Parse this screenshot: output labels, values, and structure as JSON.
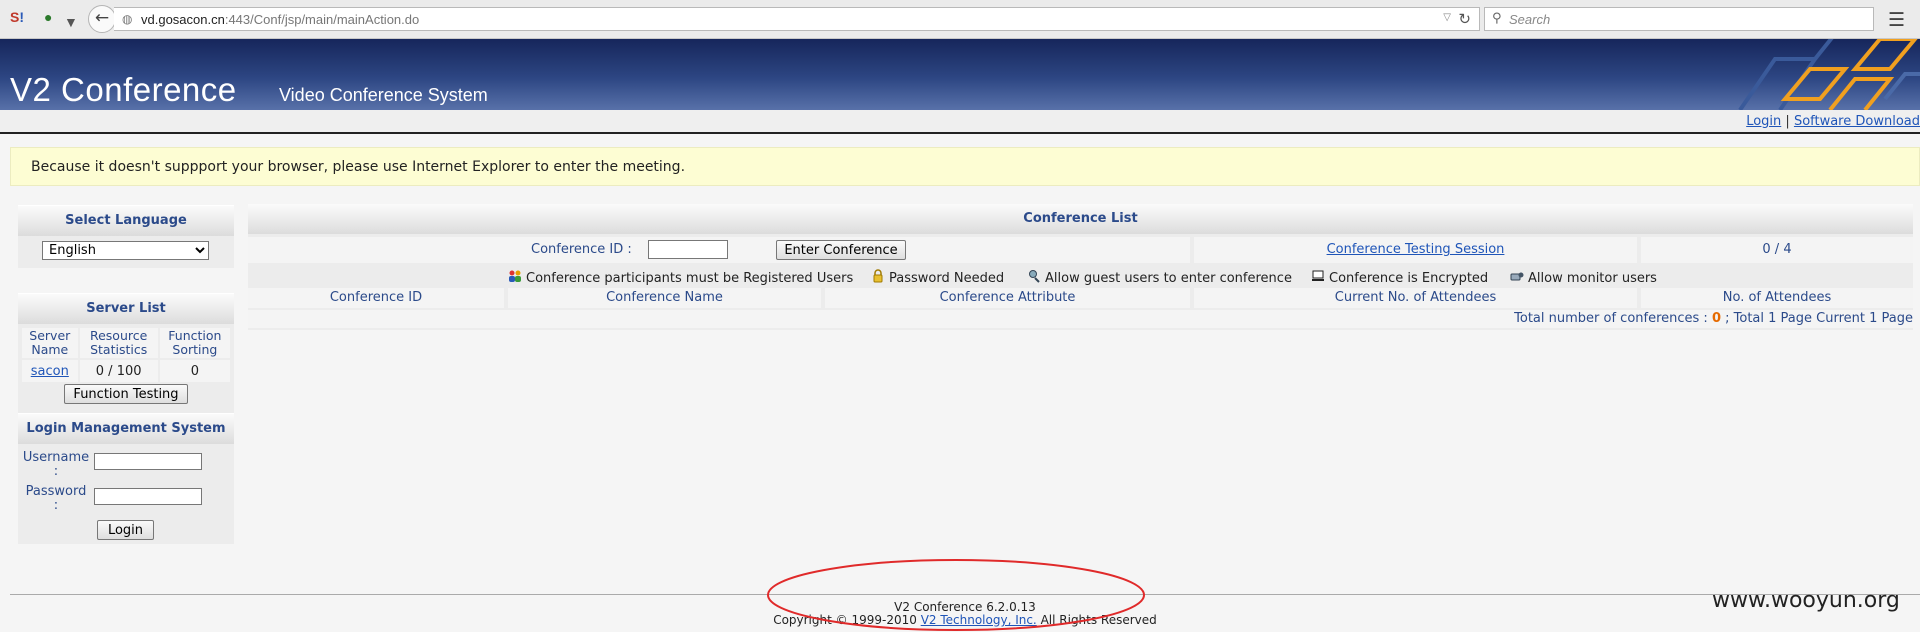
{
  "browser": {
    "url_host": "vd.gosacon.cn",
    "url_rest": ":443/Conf/jsp/main/mainAction.do",
    "search_placeholder": "Search"
  },
  "banner": {
    "title": "V2 Conference",
    "subtitle": "Video Conference System"
  },
  "nav": {
    "login": "Login",
    "separator": "|",
    "software_download": "Software Download"
  },
  "warning": "Because it doesn't suppport your browser, please use Internet Explorer to enter the meeting.",
  "language_panel": {
    "title": "Select Language",
    "selected": "English"
  },
  "server_panel": {
    "title": "Server List",
    "col_server": "Server Name",
    "col_resource": "Resource Statistics",
    "col_function": "Function Sorting",
    "server_name": "sacon",
    "resource": "0 / 100",
    "function_sort": "0",
    "function_testing_button": "Function Testing"
  },
  "login_panel": {
    "title": "Login Management System",
    "username_label": "Username",
    "password_label": "Password",
    "colon": ":",
    "login_button": "Login"
  },
  "conference": {
    "title": "Conference List",
    "conf_id_label": "Conference ID :",
    "enter_button": "Enter Conference",
    "testing_link": "Conference Testing Session",
    "testing_count": "0 / 4",
    "legend": [
      {
        "icon": "registered-users-icon",
        "text": "Conference participants must be Registered Users"
      },
      {
        "icon": "password-icon",
        "text": "Password Needed"
      },
      {
        "icon": "guest-users-icon",
        "text": "Allow guest users to enter conference"
      },
      {
        "icon": "encrypted-icon",
        "text": "Conference is Encrypted"
      },
      {
        "icon": "monitor-users-icon",
        "text": "Allow monitor users"
      }
    ],
    "columns": [
      "Conference ID",
      "Conference Name",
      "Conference Attribute",
      "Current No. of Attendees",
      "No. of Attendees"
    ],
    "total_prefix": "Total number of conferences :",
    "total_count": "0",
    "total_suffix": "; Total 1 Page Current 1 Page"
  },
  "footer": {
    "version": "V2 Conference 6.2.0.13",
    "copyright_prefix": "Copyright © 1999-2010",
    "company_link": "V2 Technology, Inc.",
    "copyright_suffix": "All Rights Reserved"
  },
  "watermark": "www.wooyun.org",
  "colors": {
    "banner": "#2d4683",
    "link": "#1f55b8",
    "label": "#2b4a8a",
    "warning_bg": "#fdfdd3",
    "annotation": "#e02a2a",
    "count_orange": "#e66a00"
  }
}
